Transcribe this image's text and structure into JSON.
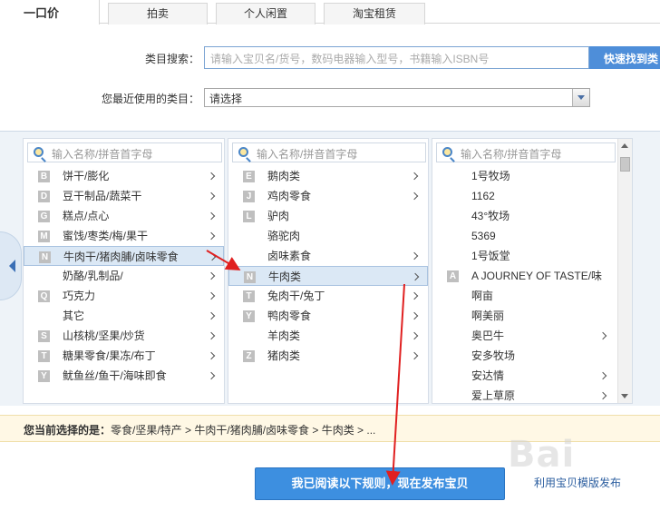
{
  "tabs": {
    "active": "一口价",
    "items": [
      "拍卖",
      "个人闲置",
      "淘宝租赁"
    ]
  },
  "search": {
    "label": "类目搜索：",
    "placeholder": "请输入宝贝名/货号，数码电器输入型号，书籍输入ISBN号",
    "button": "快速找到类"
  },
  "recent": {
    "label": "您最近使用的类目：",
    "value": "请选择"
  },
  "columns": [
    {
      "search_placeholder": "输入名称/拼音首字母",
      "items": [
        {
          "letter": "B",
          "label": "饼干/膨化",
          "has_children": true
        },
        {
          "letter": "D",
          "label": "豆干制品/蔬菜干",
          "has_children": true
        },
        {
          "letter": "G",
          "label": "糕点/点心",
          "has_children": true
        },
        {
          "letter": "M",
          "label": "蜜饯/枣类/梅/果干",
          "has_children": true
        },
        {
          "letter": "N",
          "label": "牛肉干/猪肉脯/卤味零食",
          "has_children": true,
          "selected": true
        },
        {
          "letter": "",
          "label": "奶酪/乳制品/",
          "has_children": true
        },
        {
          "letter": "Q",
          "label": "巧克力",
          "has_children": true
        },
        {
          "letter": "",
          "label": "其它",
          "has_children": true
        },
        {
          "letter": "S",
          "label": "山核桃/坚果/炒货",
          "has_children": true
        },
        {
          "letter": "T",
          "label": "糖果零食/果冻/布丁",
          "has_children": true
        },
        {
          "letter": "Y",
          "label": "鱿鱼丝/鱼干/海味即食",
          "has_children": true
        }
      ]
    },
    {
      "search_placeholder": "输入名称/拼音首字母",
      "items": [
        {
          "letter": "E",
          "label": "鹅肉类",
          "has_children": true
        },
        {
          "letter": "J",
          "label": "鸡肉零食",
          "has_children": true
        },
        {
          "letter": "L",
          "label": "驴肉",
          "has_children": false
        },
        {
          "letter": "",
          "label": "骆驼肉",
          "has_children": false
        },
        {
          "letter": "",
          "label": "卤味素食",
          "has_children": true
        },
        {
          "letter": "N",
          "label": "牛肉类",
          "has_children": true,
          "selected": true
        },
        {
          "letter": "T",
          "label": "兔肉干/兔丁",
          "has_children": true
        },
        {
          "letter": "Y",
          "label": "鸭肉零食",
          "has_children": true
        },
        {
          "letter": "",
          "label": "羊肉类",
          "has_children": true
        },
        {
          "letter": "Z",
          "label": "猪肉类",
          "has_children": true
        }
      ]
    },
    {
      "search_placeholder": "输入名称/拼音首字母",
      "items": [
        {
          "letter": "",
          "label": "1号牧场",
          "has_children": false
        },
        {
          "letter": "",
          "label": "1162",
          "has_children": false
        },
        {
          "letter": "",
          "label": "43°牧场",
          "has_children": false
        },
        {
          "letter": "",
          "label": "5369",
          "has_children": false
        },
        {
          "letter": "",
          "label": "1号饭堂",
          "has_children": false
        },
        {
          "letter": "A",
          "label": "A JOURNEY OF TASTE/味",
          "has_children": false
        },
        {
          "letter": "",
          "label": "啊亩",
          "has_children": false
        },
        {
          "letter": "",
          "label": "啊美丽",
          "has_children": false
        },
        {
          "letter": "",
          "label": "奥巴牛",
          "has_children": true
        },
        {
          "letter": "",
          "label": "安多牧场",
          "has_children": false
        },
        {
          "letter": "",
          "label": "安达情",
          "has_children": true
        },
        {
          "letter": "",
          "label": "爱上草原",
          "has_children": true
        }
      ]
    }
  ],
  "current": {
    "label": "您当前选择的是：",
    "path": "零食/坚果/特产 > 牛肉干/猪肉脯/卤味零食 > 牛肉类 > ..."
  },
  "publish_button": "我已阅读以下规则，现在发布宝贝",
  "template_link": "利用宝贝模版发布",
  "watermark": "Bai",
  "colors": {
    "accent": "#3d8fe0",
    "annotation_arrow": "#e02020",
    "selected_bg": "#dbe8f5",
    "panel_bg": "#eef3f8"
  }
}
